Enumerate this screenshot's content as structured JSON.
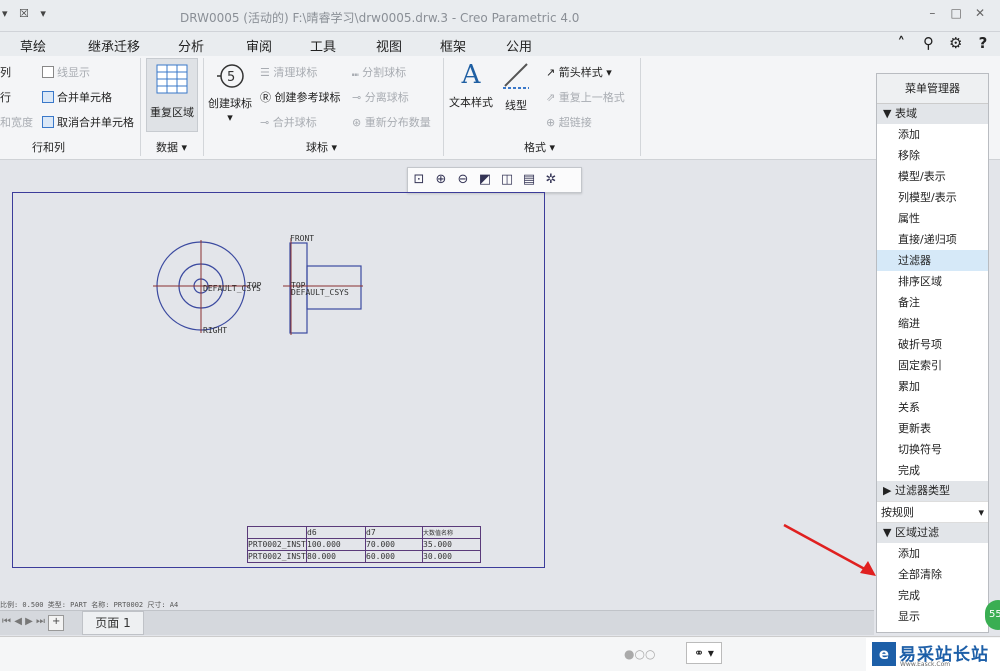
{
  "window": {
    "title": "DRW0005 (活动的) F:\\晴睿学习\\drw0005.drw.3 - Creo Parametric 4.0"
  },
  "tabs": [
    "草绘",
    "继承迁移",
    "分析",
    "审阅",
    "工具",
    "视图",
    "框架",
    "公用"
  ],
  "ribbon": {
    "rows_cols": {
      "b1": "列",
      "b2": "行",
      "b3": "和宽度",
      "b4": "线显示",
      "b5": "合并单元格",
      "b6": "取消合并单元格",
      "group": "行和列"
    },
    "data": {
      "repeat_region": "重复区域",
      "group": "数据"
    },
    "balloon": {
      "create": "创建球标",
      "clean": "清理球标",
      "create_ref": "创建参考球标",
      "merge": "合并球标",
      "split": "分割球标",
      "detach": "分离球标",
      "redistribute": "重新分布数量",
      "group": "球标"
    },
    "format": {
      "text_style": "文本样式",
      "line_style": "线型",
      "arrow_style": "箭头样式",
      "repeat_last": "重复上一格式",
      "hyperlink": "超链接",
      "group": "格式"
    }
  },
  "drawing": {
    "labels": {
      "front": "FRONT",
      "right": "RIGHT",
      "top": "TOP",
      "csys1": "DEFAULT_CSYS",
      "csys2": "DEFAULT_CSYS",
      "top2": "TOP"
    },
    "table": {
      "headers": [
        "",
        "d6",
        "d7",
        "大数值名称"
      ],
      "rows": [
        [
          "PRT0002_INST",
          "100.000",
          "70.000",
          "35.000"
        ],
        [
          "PRT0002_INST",
          "80.000",
          "60.000",
          "30.000"
        ]
      ]
    }
  },
  "status_line": "比例: 0.500  类型: PART  名称: PRT0002  尺寸: A4",
  "page_tab": "页面 1",
  "menu_manager": {
    "title": "菜单管理器",
    "section1": "表域",
    "items1": [
      "添加",
      "移除",
      "模型/表示",
      "列模型/表示",
      "属性",
      "直接/递归项",
      "过滤器",
      "排序区域",
      "备注",
      "缩进",
      "破折号项",
      "固定索引",
      "累加",
      "关系",
      "更新表",
      "切换符号",
      "完成"
    ],
    "highlighted": "过滤器",
    "section2": "过滤器类型",
    "select_value": "按规则",
    "section3": "区域过滤",
    "items3": [
      "添加",
      "全部清除",
      "完成",
      "显示"
    ]
  },
  "logo": {
    "text": "易采站长站",
    "url": "Www.Easck.Com"
  },
  "badge": "55"
}
